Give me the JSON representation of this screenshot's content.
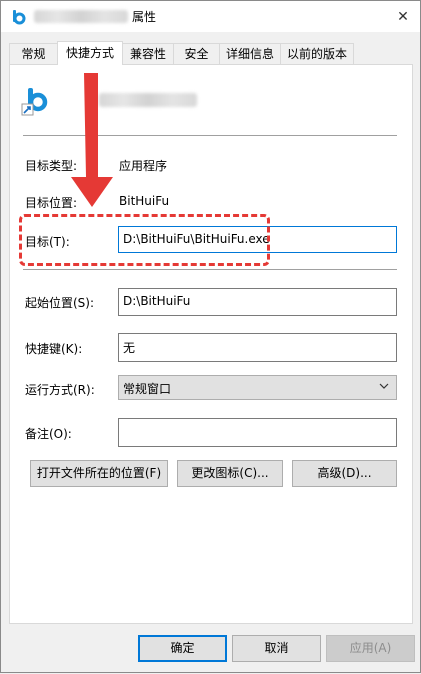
{
  "window": {
    "title_suffix": "属性",
    "close_glyph": "✕"
  },
  "tabs": [
    "常规",
    "快捷方式",
    "兼容性",
    "安全",
    "详细信息",
    "以前的版本"
  ],
  "shortcut": {
    "target_type_label": "目标类型:",
    "target_type_value": "应用程序",
    "target_location_label": "目标位置:",
    "target_location_value": "BitHuiFu",
    "target_label": "目标(T):",
    "target_value": "D:\\BitHuiFu\\BitHuiFu.exe",
    "start_in_label": "起始位置(S):",
    "start_in_value": "D:\\BitHuiFu",
    "shortcut_key_label": "快捷键(K):",
    "shortcut_key_value": "无",
    "run_label": "运行方式(R):",
    "run_value": "常规窗口",
    "comment_label": "备注(O):",
    "comment_value": "",
    "open_location_button": "打开文件所在的位置(F)",
    "change_icon_button": "更改图标(C)...",
    "advanced_button": "高级(D)..."
  },
  "footer": {
    "ok": "确定",
    "cancel": "取消",
    "apply": "应用(A)"
  },
  "colors": {
    "accent": "#0078d7",
    "annotation_red": "#e53935",
    "app_icon_blue": "#1a8fd8"
  }
}
